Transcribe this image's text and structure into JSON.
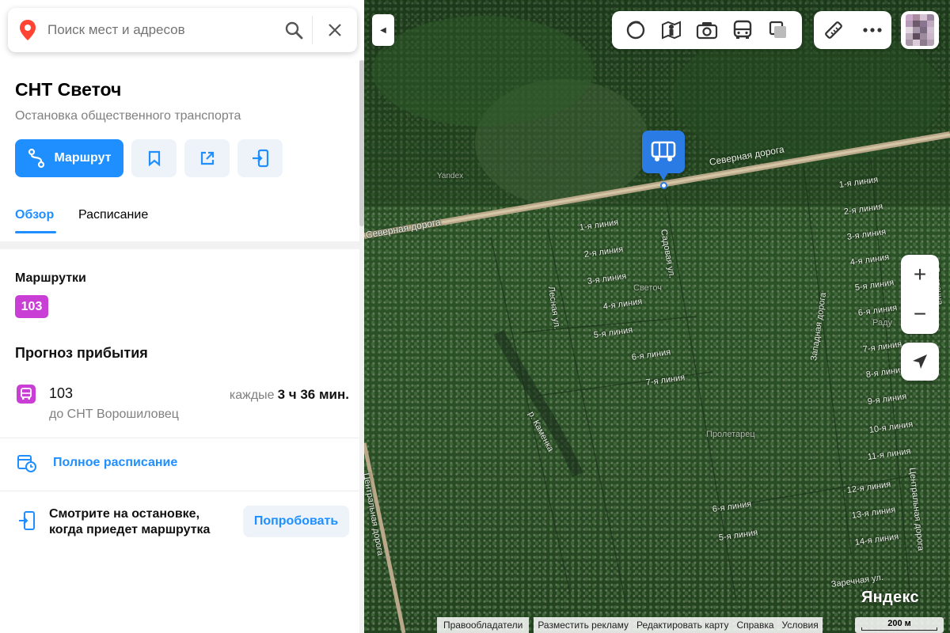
{
  "search": {
    "placeholder": "Поиск мест и адресов",
    "pin_icon": "map-pin-icon",
    "search_icon": "search-icon",
    "close_icon": "close-icon"
  },
  "stop": {
    "title": "СНТ Светоч",
    "subtitle": "Остановка общественного транспорта"
  },
  "actions": {
    "route_label": "Маршрут",
    "route_icon": "route-icon",
    "bookmark_icon": "bookmark-icon",
    "share_icon": "share-icon",
    "send_to_phone_icon": "send-to-phone-icon"
  },
  "tabs": [
    {
      "label": "Обзор",
      "active": true
    },
    {
      "label": "Расписание",
      "active": false
    }
  ],
  "minibuses": {
    "label": "Маршрутки",
    "routes": [
      "103"
    ]
  },
  "forecast": {
    "label": "Прогноз прибытия",
    "items": [
      {
        "route": "103",
        "destination": "до СНТ Ворошиловец",
        "interval_prefix": "каждые",
        "interval": "3 ч 36 мин."
      }
    ]
  },
  "full_schedule": {
    "label": "Полное расписание",
    "icon": "schedule-clock-icon"
  },
  "promo": {
    "line1": "Смотрите на остановке,",
    "line2": "когда приедет маршрутка",
    "button": "Попробовать",
    "icon": "phone-icon"
  },
  "map": {
    "labels": {
      "severnaya_right": "Северная дорога",
      "severnaya_left": "Северная дорога",
      "svetoch": "Светоч",
      "proletarets": "Пролетарец",
      "kamenka": "р. Каменка",
      "sadovaya": "Садовая ул.",
      "lesnaya": "Лесная ул.",
      "zapadnaya": "Западная дорога",
      "vostochnaya": "Восточна",
      "centralnaya_left": "Центральная дорога",
      "centralnaya_right": "Центральная дорога",
      "zarechnaya": "Заречная ул.",
      "yandex_watermark": "Yandex",
      "radu": "Раду"
    },
    "lines_left": [
      "1-я линия",
      "2-я линия",
      "3-я линия",
      "4-я линия",
      "5-я линия",
      "6-я линия",
      "7-я линия"
    ],
    "lines_right": [
      "1-я линия",
      "2-я линия",
      "3-я линия",
      "4-я линия",
      "5-я линия",
      "6-я линия",
      "7-я линия",
      "8-я линия",
      "9-я линия",
      "10-я линия",
      "11-я линия",
      "12-я линия",
      "13-я линия",
      "14-я линия"
    ],
    "lines_bottom": [
      "6-я линия",
      "5-я линия"
    ],
    "layer_icons": [
      "layers-circle-icon",
      "panorama-person-icon",
      "camera-photo-icon",
      "bus-transport-icon",
      "layers-stack-icon"
    ],
    "tool_icons": [
      "ruler-icon",
      "more-dots-icon"
    ],
    "zoom_in": "+",
    "zoom_out": "−",
    "logo": "Яндекс",
    "scale": "200 м",
    "footer": {
      "rights": "Правообладатели",
      "links": [
        "Разместить рекламу",
        "Редактировать карту",
        "Справка",
        "Условия"
      ]
    },
    "accent_color": "#1f8fff",
    "marker_color": "#2a7be4",
    "route_badge_color": "#c93fd6"
  }
}
